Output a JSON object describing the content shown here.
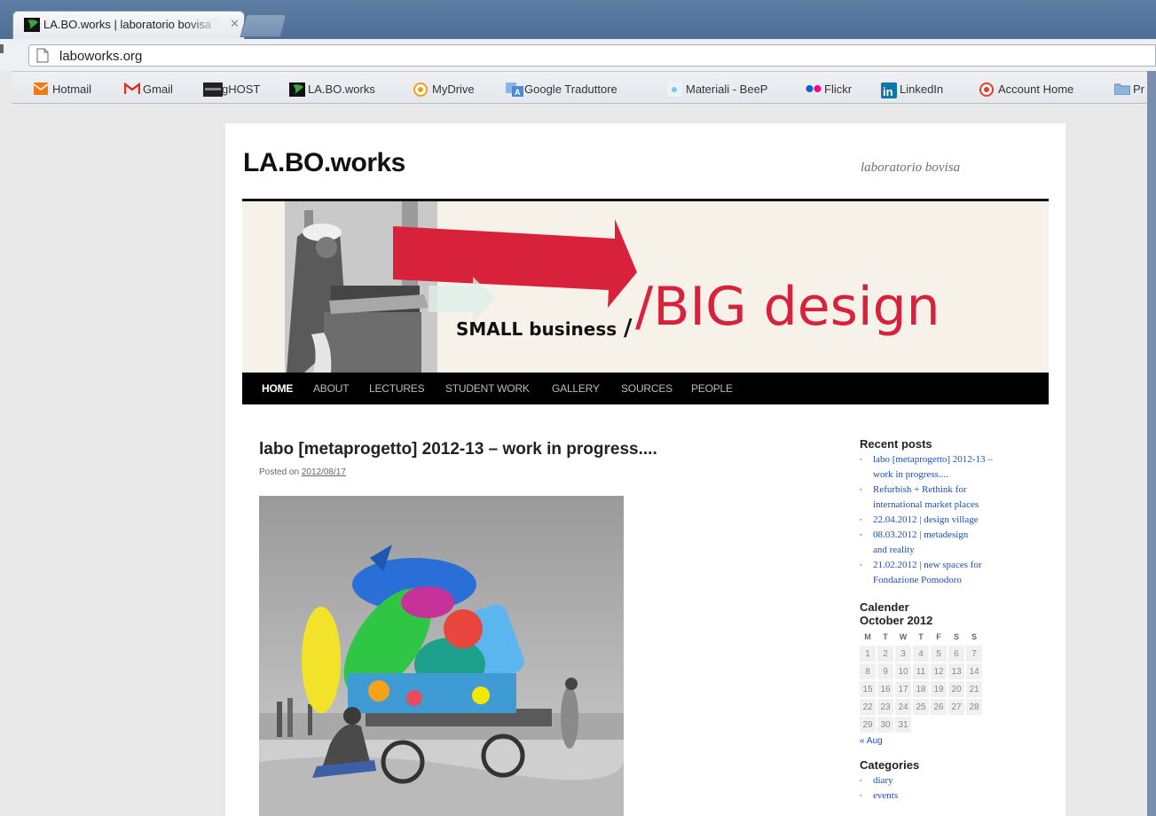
{
  "browser": {
    "tab_title": "LA.BO.works | laboratorio bovisa",
    "url": "laboworks.org"
  },
  "bookmarks": [
    {
      "label": "Hotmail",
      "icon": "hotmail-icon",
      "color": "#f07a1a"
    },
    {
      "label": "Gmail",
      "icon": "gmail-icon",
      "color": "#d93025"
    },
    {
      "label": "gHOST",
      "icon": "ghost-icon",
      "color": "#222222"
    },
    {
      "label": "LA.BO.works",
      "icon": "laboworks-icon",
      "color": "#2e9a3a"
    },
    {
      "label": "MyDrive",
      "icon": "mydrive-icon",
      "color": "#f29b1e"
    },
    {
      "label": "Google Traduttore",
      "icon": "translate-icon",
      "color": "#4a8ad8"
    },
    {
      "label": "Materiali - BeeP",
      "icon": "beep-icon",
      "color": "#7cc4e8"
    },
    {
      "label": "Flickr",
      "icon": "flickr-icon",
      "color": "#ff0084"
    },
    {
      "label": "LinkedIn",
      "icon": "linkedin-icon",
      "color": "#0e76a8"
    },
    {
      "label": "Account Home",
      "icon": "account-icon",
      "color": "#e03e2d"
    },
    {
      "label": "Pr",
      "icon": "folder-icon",
      "color": "#8fb3dc"
    }
  ],
  "site": {
    "title": "LA.BO.works",
    "description": "laboratorio bovisa"
  },
  "banner": {
    "small": "SMALL business",
    "slash_small": "/",
    "big": "/BIG design",
    "accent": "#d8213a"
  },
  "nav": [
    "HOME",
    "ABOUT",
    "LECTURES",
    "STUDENT WORK",
    "GALLERY",
    "SOURCES",
    "PEOPLE"
  ],
  "post": {
    "title": "labo [metaprogetto] 2012-13 – work in progress....",
    "posted_prefix": "Posted on",
    "date": "2012/08/17"
  },
  "sidebar": {
    "recent_title": "Recent posts",
    "recent": [
      [
        "labo [metaprogetto] 2012-13 –",
        "work in progress...."
      ],
      [
        "Refurbish + Rethink for",
        "international market places"
      ],
      [
        "22.04.2012 | design village"
      ],
      [
        "08.03.2012 | metadesign",
        "and reality"
      ],
      [
        "21.02.2012 | new spaces for",
        "Fondazione Pomodoro"
      ]
    ],
    "calendar_title": "Calender",
    "month": "October 2012",
    "weekdays": [
      "M",
      "T",
      "W",
      "T",
      "F",
      "S",
      "S"
    ],
    "weeks": [
      [
        "1",
        "2",
        "3",
        "4",
        "5",
        "6",
        "7"
      ],
      [
        "8",
        "9",
        "10",
        "11",
        "12",
        "13",
        "14"
      ],
      [
        "15",
        "16",
        "17",
        "18",
        "19",
        "20",
        "21"
      ],
      [
        "22",
        "23",
        "24",
        "25",
        "26",
        "27",
        "28"
      ],
      [
        "29",
        "30",
        "31",
        "",
        "",
        "",
        ""
      ]
    ],
    "prev_link": "« Aug",
    "categories_title": "Categories",
    "categories": [
      "diary",
      "events"
    ]
  }
}
